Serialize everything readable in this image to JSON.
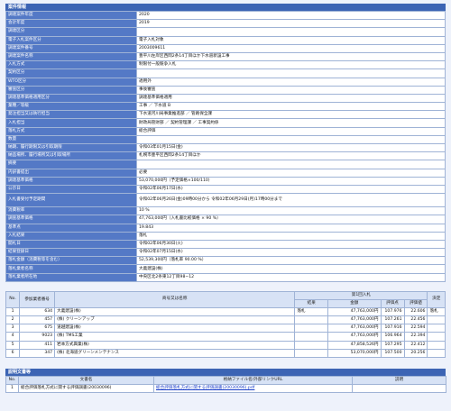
{
  "info": {
    "title": "案件情報",
    "rows": [
      {
        "label": "調達案件年度",
        "value": "2020"
      },
      {
        "label": "会計年度",
        "value": "2019"
      },
      {
        "label": "調達区分",
        "value": ""
      },
      {
        "label": "電子入札案件区分",
        "value": "電子入札対象"
      },
      {
        "label": "調達案件番号",
        "value": "2003009611"
      },
      {
        "label": "調達案件名称",
        "value": "豊平川左岸区西岡2条14丁目ほか下水道新設工事"
      },
      {
        "label": "入札方式",
        "value": "制限付一般競争入札"
      },
      {
        "label": "契約区分",
        "value": ""
      },
      {
        "label": "WTO区分",
        "value": "適用外"
      },
      {
        "label": "審査区分",
        "value": "事後審査"
      },
      {
        "label": "調達基準価格適用区分",
        "value": "調達基準価格適用"
      },
      {
        "label": "業種／等級",
        "value": "工事 ／ 下水道 B"
      },
      {
        "label": "発注担当又は執行担当",
        "value": "下水道河川局事業推進部 ／ 管路保全課"
      },
      {
        "label": "入札担当",
        "value": "財政局管財部 ／ 契約管理課 ／ 工事契約係"
      },
      {
        "label": "落札方式",
        "value": "総合評価"
      },
      {
        "label": "数量",
        "value": ""
      },
      {
        "label": "納期、履行期限又は引取期限",
        "value": "令和03年01月15日(金)"
      },
      {
        "label": "納品場所、履行場所又は引取場所",
        "value": "札幌市豊平区西岡2条14丁目ほか"
      },
      {
        "label": "摘要",
        "value": ""
      },
      {
        "label": "内訳書提出",
        "value": "必要"
      },
      {
        "label": "調達基準価格",
        "value": "53,070,000円（予定価格×100/110）"
      },
      {
        "label": "公示日",
        "value": "令和02年06月17日(水)"
      },
      {
        "label": "入札書受付予定期間",
        "value": "令和02年06月26日(金)09時00分から 令和02年06月29日(月)17時00分まで"
      },
      {
        "label": "消費税率",
        "value": "10 %"
      },
      {
        "label": "調査基準価格",
        "value": "47,763,000円（入札書比較価格 × 90 %）"
      },
      {
        "label": "基準点",
        "value": "19.843"
      },
      {
        "label": "入札結果",
        "value": "落札"
      },
      {
        "label": "開札日",
        "value": "令和02年06月30日(火)"
      },
      {
        "label": "結果登録日",
        "value": "令和02年07月15日(水)"
      },
      {
        "label": "落札金額（消費税等を含む）",
        "value": "52,539,300円（落札率 90.00 %）"
      },
      {
        "label": "落札業者名称",
        "value": "大義建設(株)"
      },
      {
        "label": "落札業者所在地",
        "value": "中央区北2条東12丁目98−12"
      }
    ]
  },
  "bids": {
    "headers": {
      "no": "No.",
      "member": "参加業者番号",
      "name": "商号又は名称",
      "round": "第1回入札",
      "result": "結果",
      "amount": "金額",
      "score": "評価点",
      "rate": "評価値",
      "decision": "決定"
    },
    "rows": [
      {
        "no": "1",
        "member": "634",
        "name": "大義建設(株)",
        "result": "落札",
        "amount": "47,763,000円",
        "score": "107.976",
        "rate": "22.606",
        "decision": "落札"
      },
      {
        "no": "2",
        "member": "457",
        "name": "(株) クリーンアップ",
        "result": "",
        "amount": "47,763,000円",
        "score": "107.261",
        "rate": "22.456",
        "decision": ""
      },
      {
        "no": "3",
        "member": "675",
        "name": "道越建設(株)",
        "result": "",
        "amount": "47,763,000円",
        "score": "107.916",
        "rate": "22.594",
        "decision": ""
      },
      {
        "no": "4",
        "member": "9023",
        "name": "(株) TMS工業",
        "result": "",
        "amount": "47,763,000円",
        "score": "106.964",
        "rate": "22.394",
        "decision": ""
      },
      {
        "no": "5",
        "member": "411",
        "name": "岩本方式興業(株)",
        "result": "",
        "amount": "47,858,526円",
        "score": "107.295",
        "rate": "22.412",
        "decision": ""
      },
      {
        "no": "6",
        "member": "347",
        "name": "(株) 北海道グリーンメンテナンス",
        "result": "",
        "amount": "53,070,000円",
        "score": "107.500",
        "rate": "20.256",
        "decision": ""
      }
    ]
  },
  "docs": {
    "title": "説明文書等",
    "headers": {
      "no": "No.",
      "name": "文書名",
      "file": "格納ファイル名/外部リンクURL",
      "desc": "説明"
    },
    "rows": [
      {
        "no": "1",
        "name": "総合評価落札方式に関する評価調書(20030096)",
        "file": "総合評価落札方式に関する評価調書(20030096).pdf",
        "desc": ""
      }
    ]
  }
}
